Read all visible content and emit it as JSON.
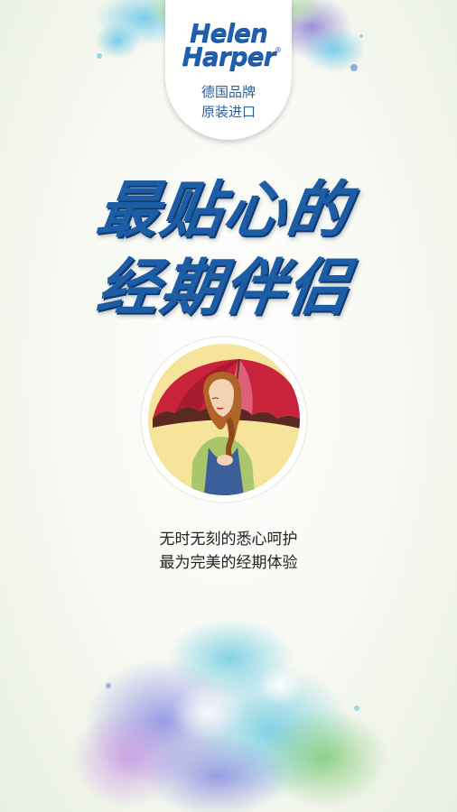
{
  "brand": {
    "line1": "Helen",
    "line2": "Harper",
    "registered": "®",
    "origin_line1": "德国品牌",
    "origin_line2": "原装进口"
  },
  "headline": {
    "line1": "最贴心的",
    "line2": "经期伴侣"
  },
  "tagline": {
    "line1": "无时无刻的悉心呵护",
    "line2": "最为完美的经期体验"
  },
  "colors": {
    "brand_blue": "#1f5fb0",
    "umbrella_red": "#c8233a",
    "badge_circle": "#f5e49a"
  },
  "icons": [
    "umbrella-woman-illustration",
    "watercolor-splash-top",
    "watercolor-flower-bottom"
  ]
}
